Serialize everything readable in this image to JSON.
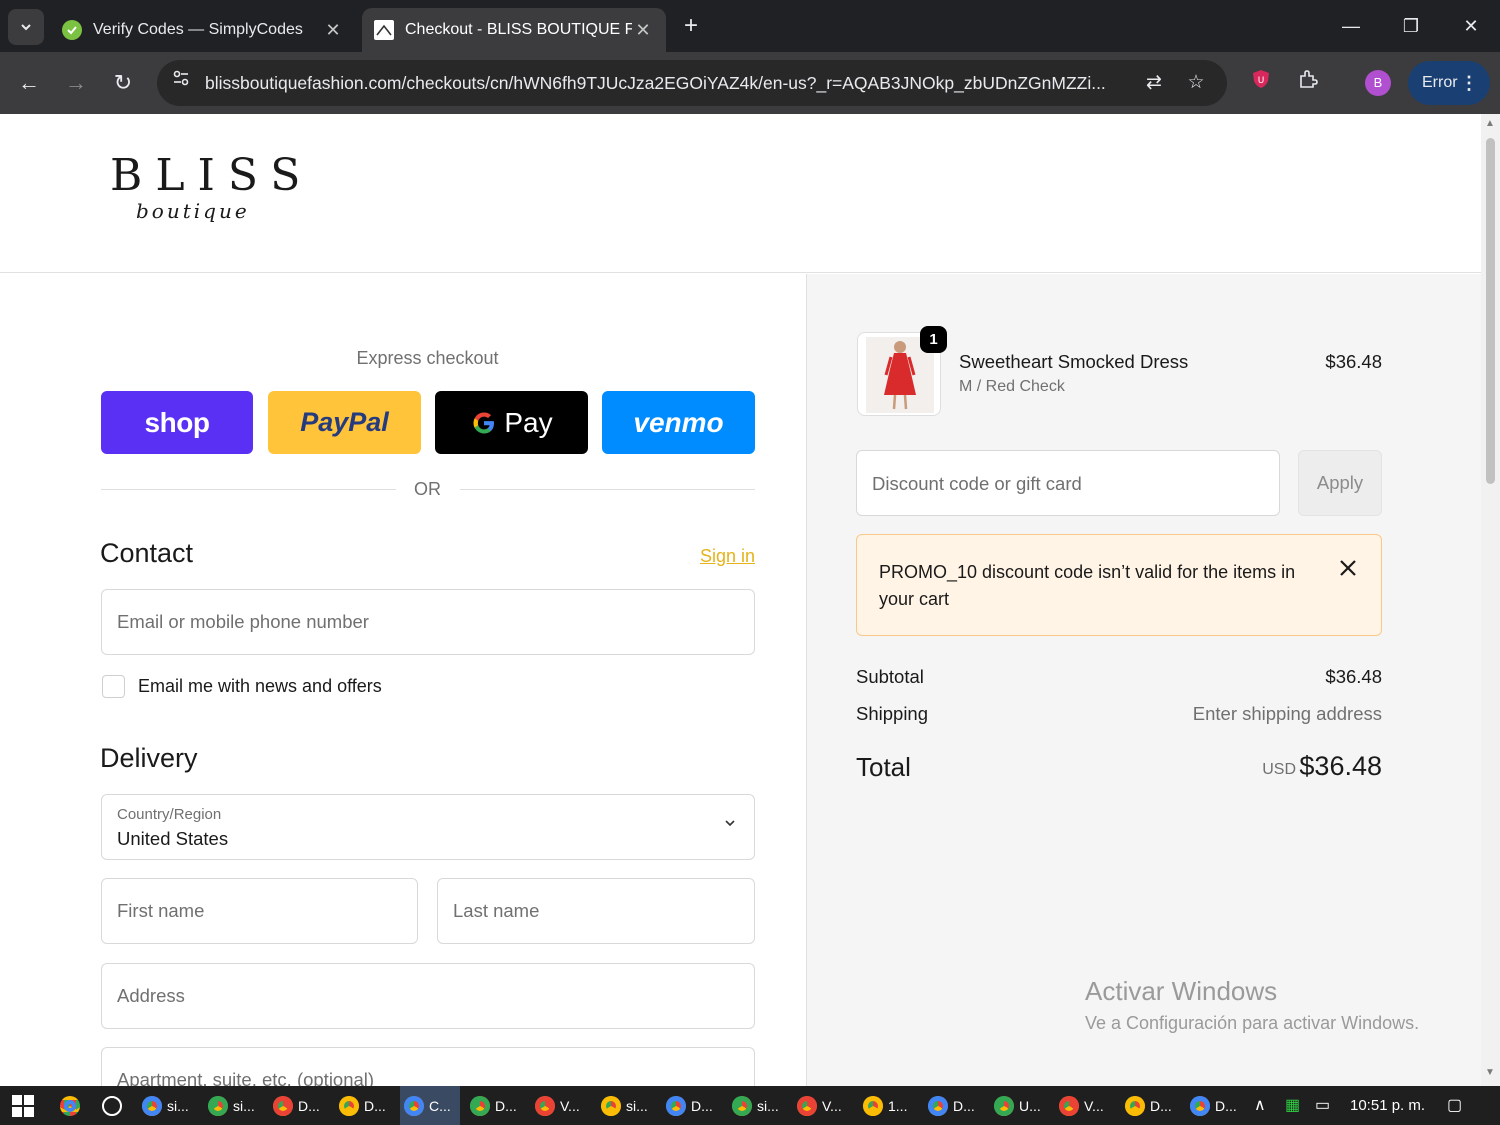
{
  "browser": {
    "tabs": [
      {
        "title": "Verify Codes — SimplyCodes",
        "active": false
      },
      {
        "title": "Checkout - BLISS BOUTIQUE FASHION",
        "active": true
      }
    ],
    "url": "blissboutiquefashion.com/checkouts/cn/hWN6fh9TJUcJza2EGOiYAZ4k/en-us?_r=AQAB3JNOkp_zbUDnZGnMZZi...",
    "profile_initial": "B",
    "error_label": "Error"
  },
  "header": {
    "logo_text": "BLISS",
    "logo_subtext": "boutique"
  },
  "checkout": {
    "express_label": "Express checkout",
    "pay_buttons": [
      {
        "label": "shop",
        "color": "#5a31f4"
      },
      {
        "label": "PayPal",
        "color": "#ffc439"
      },
      {
        "label": "Pay",
        "color": "#000000"
      },
      {
        "label": "venmo",
        "color": "#008cff"
      }
    ],
    "or_label": "OR",
    "contact": {
      "title": "Contact",
      "sign_in": "Sign in",
      "email_placeholder": "Email or mobile phone number",
      "newsletter_label": "Email me with news and offers"
    },
    "delivery": {
      "title": "Delivery",
      "country_label": "Country/Region",
      "country_value": "United States",
      "first_name_placeholder": "First name",
      "last_name_placeholder": "Last name",
      "address_placeholder": "Address",
      "apartment_placeholder": "Apartment, suite, etc. (optional)"
    }
  },
  "summary": {
    "item": {
      "quantity": "1",
      "name": "Sweetheart Smocked Dress",
      "variant": "M / Red Check",
      "price": "$36.48"
    },
    "discount_placeholder": "Discount code or gift card",
    "apply_label": "Apply",
    "alert_message": "PROMO_10 discount code isn’t valid for the items in your cart",
    "subtotal_label": "Subtotal",
    "subtotal_value": "$36.48",
    "shipping_label": "Shipping",
    "shipping_value": "Enter shipping address",
    "total_label": "Total",
    "total_currency": "USD",
    "total_value": "$36.48"
  },
  "watermark": {
    "line1": "Activar Windows",
    "line2": "Ve a Configuración para activar Windows."
  },
  "taskbar": {
    "items": [
      "si...",
      "si...",
      "D...",
      "D...",
      "C...",
      "D...",
      "V...",
      "si...",
      "D...",
      "si...",
      "V...",
      "1...",
      "D...",
      "U...",
      "V...",
      "D...",
      "D..."
    ],
    "clock": "10:51 p. m."
  }
}
